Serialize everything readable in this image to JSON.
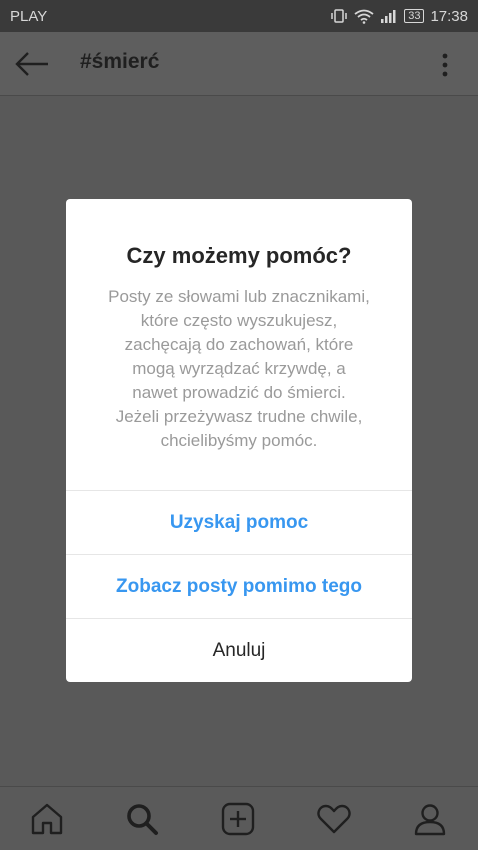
{
  "status_bar": {
    "carrier": "PLAY",
    "battery": "33",
    "time": "17:38"
  },
  "header": {
    "title": "#śmierć"
  },
  "dialog": {
    "title": "Czy możemy pomóc?",
    "message": "Posty ze słowami lub znacznikami,\nktóre często wyszukujesz,\nzachęcają do zachowań, które\nmogą wyrządzać krzywdę, a\nnawet prowadzić do śmierci.\nJeżeli przeżywasz trudne chwile,\nchcielibyśmy pomóc.",
    "buttons": {
      "get_help": "Uzyskaj pomoc",
      "see_posts": "Zobacz posty pomimo tego",
      "cancel": "Anuluj"
    }
  },
  "nav": {
    "icons": [
      "home-icon",
      "search-icon",
      "add-post-icon",
      "heart-icon",
      "profile-icon"
    ]
  },
  "colors": {
    "link_blue": "#3897f0",
    "dialog_bg": "#ffffff",
    "dim_overlay": "#595959"
  }
}
